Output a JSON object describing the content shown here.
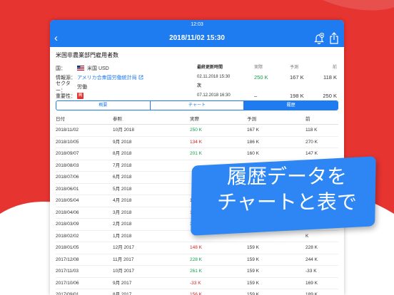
{
  "status_time": "12:03",
  "nav": {
    "title": "2018/11/02 15:30"
  },
  "event": {
    "title": "米国非農業部門雇用者数",
    "country_label": "国：",
    "country_value": "米国 USD",
    "source_label": "情報源：",
    "source_value": "アメリカ合衆国労働統計局",
    "sector_label": "セクター：",
    "sector_value": "労働",
    "importance_label": "重要性：",
    "importance_value": "高"
  },
  "latest": {
    "header_label": "最終更新時間",
    "actual_label": "実際",
    "forecast_label": "予測",
    "previous_label": "前",
    "date": "02.11.2018 15:30",
    "actual": "250 K",
    "forecast": "167 K",
    "previous": "118 K"
  },
  "next": {
    "header_label": "次",
    "date": "07.12.2018 16:30",
    "actual": "–",
    "forecast": "198 K",
    "previous": "250 K"
  },
  "tabs": [
    "概要",
    "チャート",
    "履歴"
  ],
  "table": {
    "headers": [
      "日付",
      "参照",
      "実際",
      "予測",
      "前"
    ],
    "rows": [
      {
        "date": "2018/11/02",
        "ref": "10月 2018",
        "actual": "250 K",
        "forecast": "167 K",
        "previous": "118 K",
        "color": "green"
      },
      {
        "date": "2018/10/05",
        "ref": "9月 2018",
        "actual": "134 K",
        "forecast": "186 K",
        "previous": "270 K",
        "color": "red"
      },
      {
        "date": "2018/09/07",
        "ref": "8月 2018",
        "actual": "201 K",
        "forecast": "160 K",
        "previous": "147 K",
        "color": "green"
      },
      {
        "date": "2018/08/03",
        "ref": "7月 2018",
        "actual": "",
        "forecast": "",
        "previous": "",
        "color": ""
      },
      {
        "date": "2018/07/06",
        "ref": "6月 2018",
        "actual": "",
        "forecast": "",
        "previous": "",
        "color": ""
      },
      {
        "date": "2018/06/01",
        "ref": "5月 2018",
        "actual": "",
        "forecast": "",
        "previous": "",
        "color": ""
      },
      {
        "date": "2018/05/04",
        "ref": "4月 2018",
        "actual": "1",
        "forecast": "",
        "previous": "",
        "color": ""
      },
      {
        "date": "2018/04/06",
        "ref": "3月 2018",
        "actual": "1",
        "forecast": "",
        "previous": "",
        "color": "red"
      },
      {
        "date": "2018/03/09",
        "ref": "2月 2018",
        "actual": "31",
        "forecast": "",
        "previous": "",
        "color": "green"
      },
      {
        "date": "2018/02/02",
        "ref": "1月 2018",
        "actual": "",
        "forecast": "",
        "previous": "K",
        "color": ""
      },
      {
        "date": "2018/01/05",
        "ref": "12月 2017",
        "actual": "148 K",
        "forecast": "159 K",
        "previous": "228 K",
        "color": "red"
      },
      {
        "date": "2017/12/08",
        "ref": "11月 2017",
        "actual": "228 K",
        "forecast": "159 K",
        "previous": "244 K",
        "color": "green"
      },
      {
        "date": "2017/11/03",
        "ref": "10月 2017",
        "actual": "261 K",
        "forecast": "159 K",
        "previous": "-33 K",
        "color": "green"
      },
      {
        "date": "2017/10/06",
        "ref": "9月 2017",
        "actual": "-33 K",
        "forecast": "159 K",
        "previous": "169 K",
        "color": "red"
      },
      {
        "date": "2017/09/01",
        "ref": "8月 2017",
        "actual": "156 K",
        "forecast": "159 K",
        "previous": "189 K",
        "color": "red"
      }
    ]
  },
  "banner": {
    "line1": "履歴データを",
    "line2": "チャートと表で"
  },
  "colors": {
    "brand_blue": "#1f7cf0",
    "background_red": "#e63431",
    "positive": "#14a04a",
    "negative": "#d52020"
  },
  "icons": {
    "back": "chevron-left-icon",
    "alert": "bell-plus-icon",
    "share": "share-icon",
    "flag": "us-flag-icon",
    "external": "external-link-icon"
  }
}
